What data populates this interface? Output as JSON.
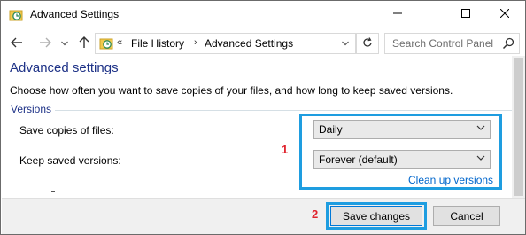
{
  "window": {
    "title": "Advanced Settings",
    "app_icon": "file-history-icon",
    "controls": {
      "minimize": "minimize-icon",
      "maximize": "maximize-icon",
      "close": "close-icon"
    }
  },
  "nav": {
    "back_icon": "arrow-left-icon",
    "forward_icon": "arrow-right-icon",
    "recent_icon": "chevron-down-icon",
    "up_icon": "arrow-up-icon"
  },
  "address": {
    "overflow": "«",
    "separator": "›",
    "segments": [
      "File History",
      "Advanced Settings"
    ],
    "dropdown_icon": "chevron-down-icon",
    "refresh_icon": "refresh-icon"
  },
  "search": {
    "placeholder": "Search Control Panel",
    "icon": "search-icon"
  },
  "content": {
    "heading": "Advanced settings",
    "description": "Choose how often you want to save copies of your files, and how long to keep saved versions.",
    "group": "Versions",
    "save_copies_label": "Save copies of files:",
    "save_copies_value": "Daily",
    "keep_versions_label": "Keep saved versions:",
    "keep_versions_value": "Forever (default)",
    "clean_up_link": "Clean up versions"
  },
  "annotations": {
    "step1": "1",
    "step2": "2",
    "highlight_color": "#1e9de0",
    "number_color": "#e0212b"
  },
  "footer": {
    "save_label": "Save changes",
    "cancel_label": "Cancel"
  },
  "colors": {
    "heading": "#1e3287",
    "link": "#0066cc",
    "footer_bg": "#f0f0f0"
  }
}
